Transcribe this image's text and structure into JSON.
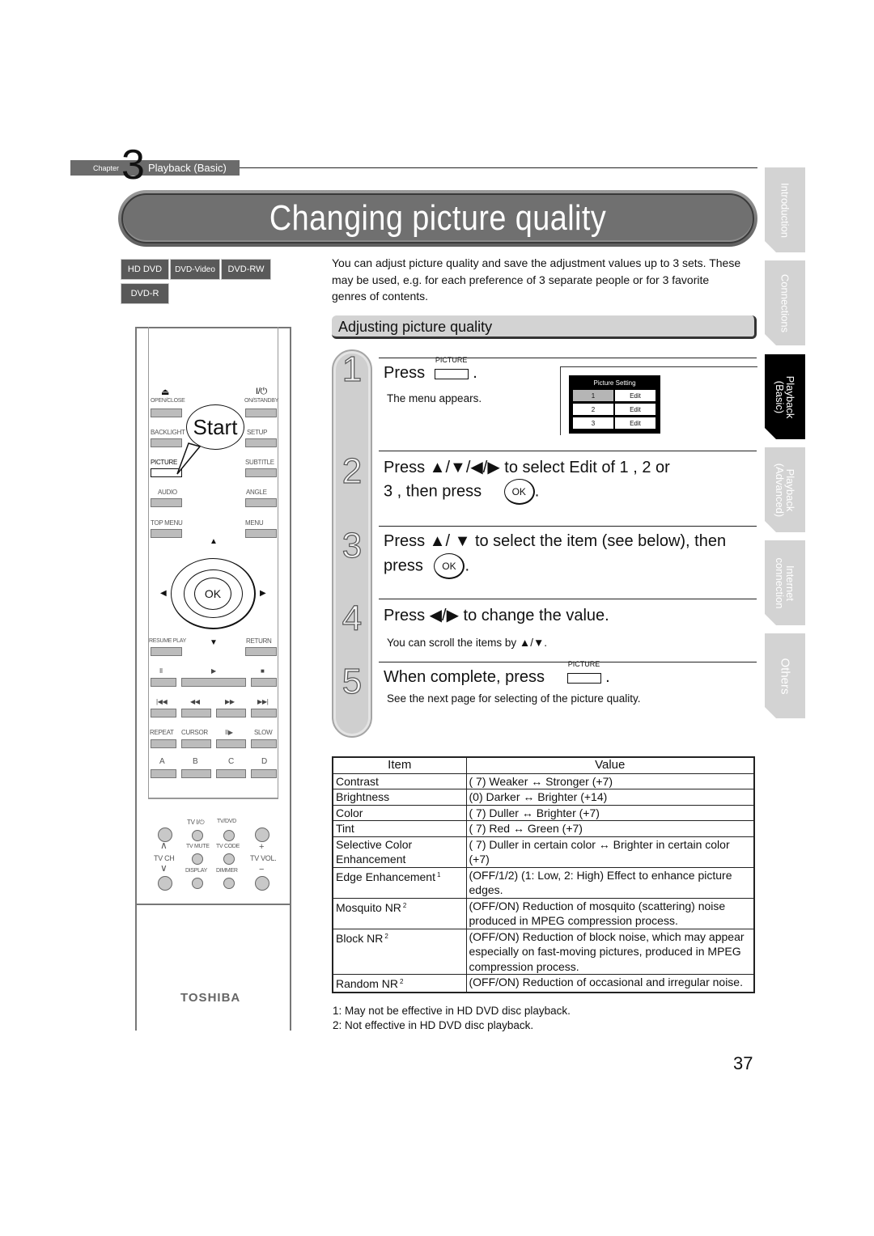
{
  "header": {
    "chapter_label": "Chapter",
    "chapter_number": "3",
    "chapter_name": "Playback (Basic)",
    "title": "Changing picture quality"
  },
  "disc_badges": [
    "HD DVD",
    "DVD-Video",
    "DVD-RW",
    "DVD-R"
  ],
  "intro": "You can adjust picture quality and save the adjustment values up to 3 sets. These may be used, e.g. for each preference of 3 separate people or for 3 favorite genres of contents.",
  "section_title": "Adjusting picture quality",
  "steps": [
    {
      "number": "1",
      "press": "Press",
      "button_caption": "PICTURE",
      "end": ".",
      "sub": "The menu appears."
    },
    {
      "number": "2",
      "line1": "Press ▲/▼/◀/▶ to select  Edit  of  1 ,  2  or",
      "line2": " 3 , then press",
      "ok_label": "OK",
      "end": "."
    },
    {
      "number": "3",
      "line1": "Press ▲/ ▼ to select the item (see below), then",
      "line2": "press",
      "ok_label": "OK",
      "end": "."
    },
    {
      "number": "4",
      "head": "Press ◀/▶ to change the value.",
      "sub": "You can scroll the items by  ▲/▼."
    },
    {
      "number": "5",
      "head": "When complete, press",
      "button_caption": "PICTURE",
      "end": ".",
      "sub": "See the next page for selecting of the picture quality."
    }
  ],
  "menu_preview": {
    "title": "Picture Setting",
    "rows": [
      {
        "num": "1",
        "action": "Edit",
        "selected": true
      },
      {
        "num": "2",
        "action": "Edit",
        "selected": false
      },
      {
        "num": "3",
        "action": "Edit",
        "selected": false
      }
    ]
  },
  "side_tabs": [
    {
      "label": "Introduction",
      "active": false
    },
    {
      "label": "Connections",
      "active": false
    },
    {
      "label": "Playback\n(Basic)",
      "active": true
    },
    {
      "label": "Playback\n(Advanced)",
      "active": false
    },
    {
      "label": "Internet\nconnection",
      "active": false
    },
    {
      "label": "Others",
      "active": false
    }
  ],
  "table": {
    "headers": [
      "Item",
      "Value"
    ],
    "rows": [
      {
        "item": "Contrast",
        "note": "",
        "value": "( 7) Weaker ↔ Stronger (+7)"
      },
      {
        "item": "Brightness",
        "note": "",
        "value": "(0) Darker ↔ Brighter (+14)"
      },
      {
        "item": "Color",
        "note": "",
        "value": "( 7) Duller ↔ Brighter (+7)"
      },
      {
        "item": "Tint",
        "note": "",
        "value": "( 7) Red ↔ Green (+7)"
      },
      {
        "item": "Selective Color Enhancement",
        "note": "",
        "value": "( 7) Duller in certain color ↔ Brighter in certain color (+7)"
      },
      {
        "item": "Edge Enhancement",
        "note": "1",
        "value": "(OFF/1/2) (1: Low, 2: High) Effect to enhance picture edges."
      },
      {
        "item": "Mosquito NR",
        "note": "2",
        "value": "(OFF/ON) Reduction of mosquito (scattering) noise produced in MPEG compression process."
      },
      {
        "item": "Block NR",
        "note": "2",
        "value": "(OFF/ON) Reduction of block noise, which may appear especially on fast-moving pictures, produced in MPEG compression process."
      },
      {
        "item": "Random NR",
        "note": "2",
        "value": "(OFF/ON) Reduction of occasional and irregular noise."
      }
    ]
  },
  "footnotes": [
    "1: May not be effective in HD DVD disc playback.",
    "2: Not effective in HD DVD disc playback."
  ],
  "page_number": "37",
  "remote": {
    "start_label": "Start",
    "brand": "TOSHIBA",
    "ok_label": "OK",
    "labels": {
      "open_close": "OPEN/CLOSE",
      "on_standby": "ON/STANDBY",
      "power_glyph": "I/⏻",
      "eject_glyph": "⏏",
      "backlight": "BACKLIGHT",
      "setup": "SETUP",
      "picture": "PICTURE",
      "subtitle": "SUBTITLE",
      "audio": "AUDIO",
      "angle": "ANGLE",
      "top_menu": "TOP MENU",
      "menu": "MENU",
      "resume_play": "RESUME PLAY",
      "return": "RETURN",
      "pause": "II",
      "play": "▶",
      "stop": "■",
      "skip_back": "|◀◀",
      "rewind": "◀◀",
      "fast_forward": "▶▶",
      "skip_forward": "▶▶|",
      "repeat": "REPEAT",
      "cursor": "CURSOR",
      "step": "II▶",
      "slow": "SLOW",
      "a": "A",
      "b": "B",
      "c": "C",
      "d": "D",
      "tv_power": "TV  I/⏻",
      "tv_dvd": "TV/DVD",
      "tv_mute": "TV MUTE",
      "tv_code": "TV CODE",
      "display": "DISPLAY",
      "dimmer": "DIMMER",
      "tv_ch": "TV CH",
      "tv_vol": "TV VOL.",
      "ch_up": "∧",
      "ch_down": "∨",
      "vol_up": "+",
      "vol_down": "−"
    }
  }
}
